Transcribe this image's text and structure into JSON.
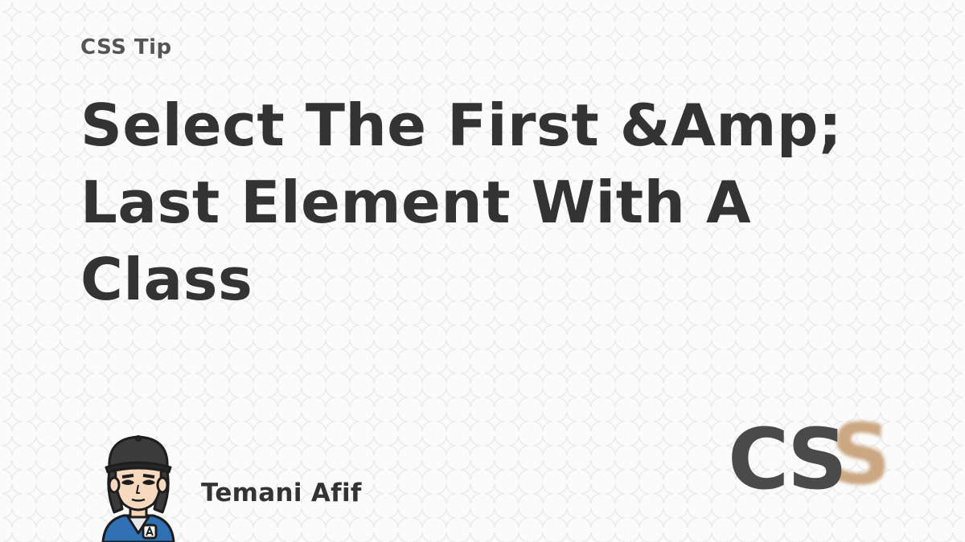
{
  "card": {
    "label": "CSS Tip",
    "title": "Select The First &Amp; Last Element With A Class",
    "author": "Temani Afif"
  },
  "logo": {
    "letters": [
      "C",
      "S",
      "S"
    ],
    "dark_color": "#4a4a4a",
    "accent_color": "#c9a37c"
  },
  "icons": {
    "avatar": "cartoon-avatar-icon",
    "logo": "css-logo-icon"
  },
  "colors": {
    "background": "#fbfbfb",
    "pattern": "#ececec",
    "text": "#333333",
    "label": "#555555"
  }
}
